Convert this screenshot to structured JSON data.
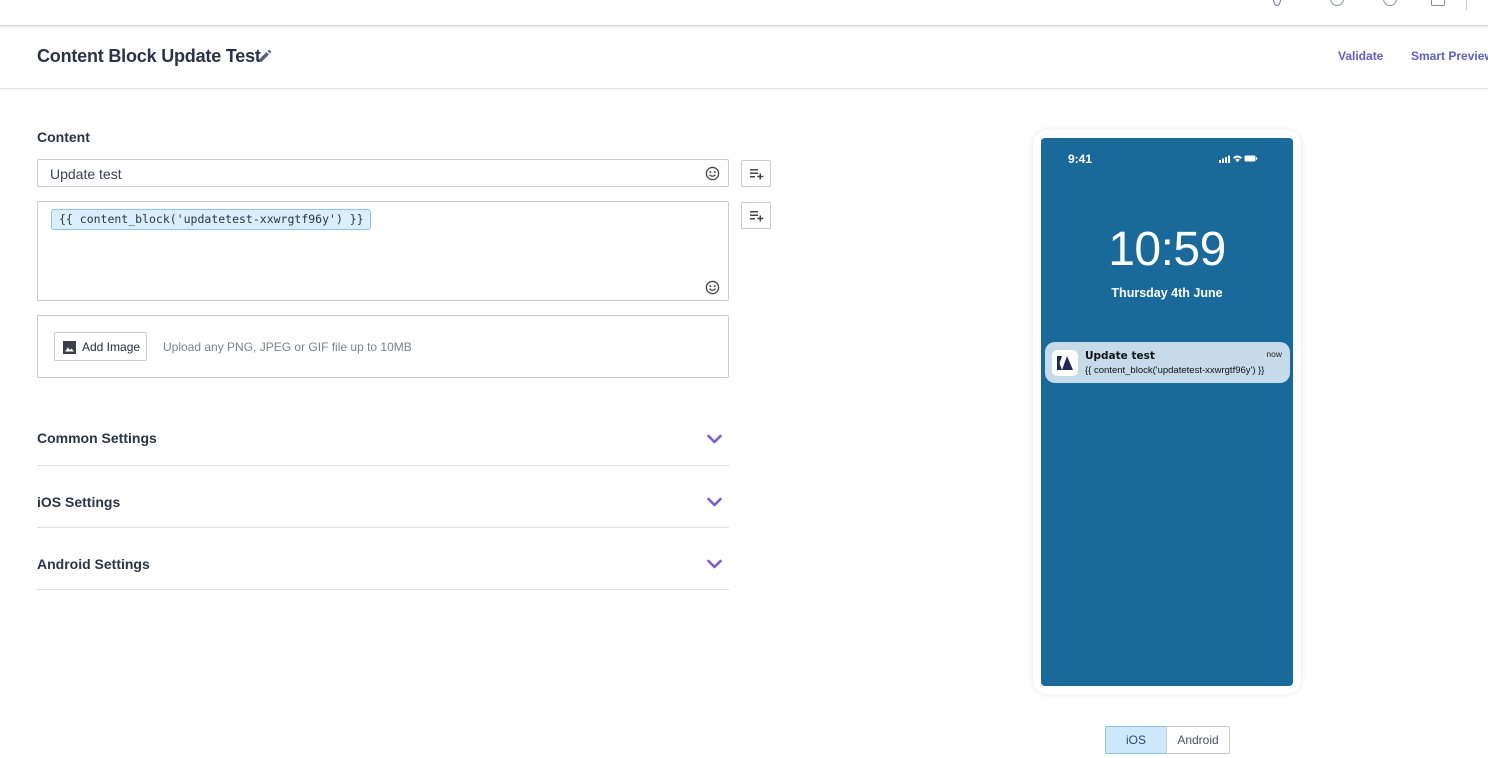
{
  "header": {
    "title": "Content Block Update Test",
    "actions": {
      "validate": "Validate",
      "smart_preview": "Smart Preview"
    }
  },
  "content": {
    "section_label": "Content",
    "title_field": {
      "value": "Update test"
    },
    "body_field": {
      "token": "{{ content_block('updatetest-xxwrgtf96y') }}"
    },
    "image": {
      "button_label": "Add Image",
      "hint": "Upload any PNG, JPEG or GIF file up to 10MB"
    }
  },
  "settings": [
    {
      "label": "Common Settings"
    },
    {
      "label": "iOS Settings"
    },
    {
      "label": "Android Settings"
    }
  ],
  "preview": {
    "status_time": "9:41",
    "lock_time": "10:59",
    "lock_date": "Thursday 4th June",
    "notification": {
      "title": "Update test",
      "time": "now",
      "body": "{{ content_block('updatetest-xxwrgtf96y') }}"
    },
    "platform_toggle": {
      "ios": "iOS",
      "android": "Android",
      "selected": "iOS"
    }
  },
  "colors": {
    "accent": "#5e5ec9",
    "chevron": "#7b5cd6",
    "phone_screen": "#19699b",
    "notification_bg": "#c5dbe9",
    "token_bg": "#dbeefc"
  }
}
